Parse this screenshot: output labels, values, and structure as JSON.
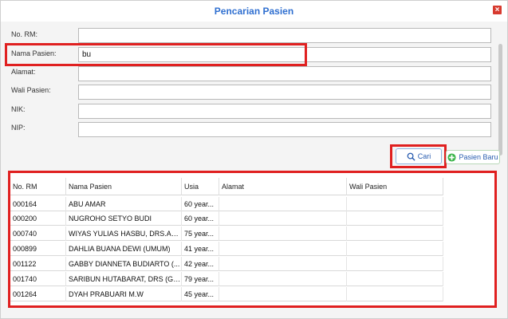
{
  "dialog": {
    "title": "Pencarian Pasien",
    "close_icon": "close-icon"
  },
  "form": {
    "labels": {
      "no_rm": "No. RM:",
      "nama_pasien": "Nama Pasien:",
      "alamat": "Alamat:",
      "wali_pasien": "Wali Pasien:",
      "nik": "NIK:",
      "nip": "NIP:"
    },
    "values": {
      "no_rm": "",
      "nama_pasien": "bu",
      "alamat": "",
      "wali_pasien": "",
      "nik": "",
      "nip": ""
    }
  },
  "buttons": {
    "cari": "Cari",
    "pasien_baru": "Pasien Baru"
  },
  "table": {
    "columns": [
      "No. RM",
      "Nama Pasien",
      "Usia",
      "Alamat",
      "Wali Pasien"
    ],
    "rows": [
      [
        "000164",
        "ABU AMAR",
        "60 year...",
        "",
        ""
      ],
      [
        "000200",
        "NUGROHO SETYO BUDI",
        "60 year...",
        "",
        ""
      ],
      [
        "000740",
        "WIYAS YULIAS HASBU, DRS.Ak,...",
        "75 year...",
        "",
        ""
      ],
      [
        "000899",
        "DAHLIA BUANA DEWI (UMUM)",
        "41 year...",
        "",
        ""
      ],
      [
        "001122",
        "GABBY DIANNETA BUDIARTO (...",
        "42 year...",
        "",
        ""
      ],
      [
        "001740",
        "SARIBUN HUTABARAT, DRS (GA...",
        "79 year...",
        "",
        ""
      ],
      [
        "001264",
        "DYAH PRABUARI M.W",
        "45 year...",
        "",
        ""
      ]
    ]
  },
  "colors": {
    "accent": "#2f6fd0",
    "highlight": "#e02020",
    "add_icon": "#3bb54a"
  }
}
